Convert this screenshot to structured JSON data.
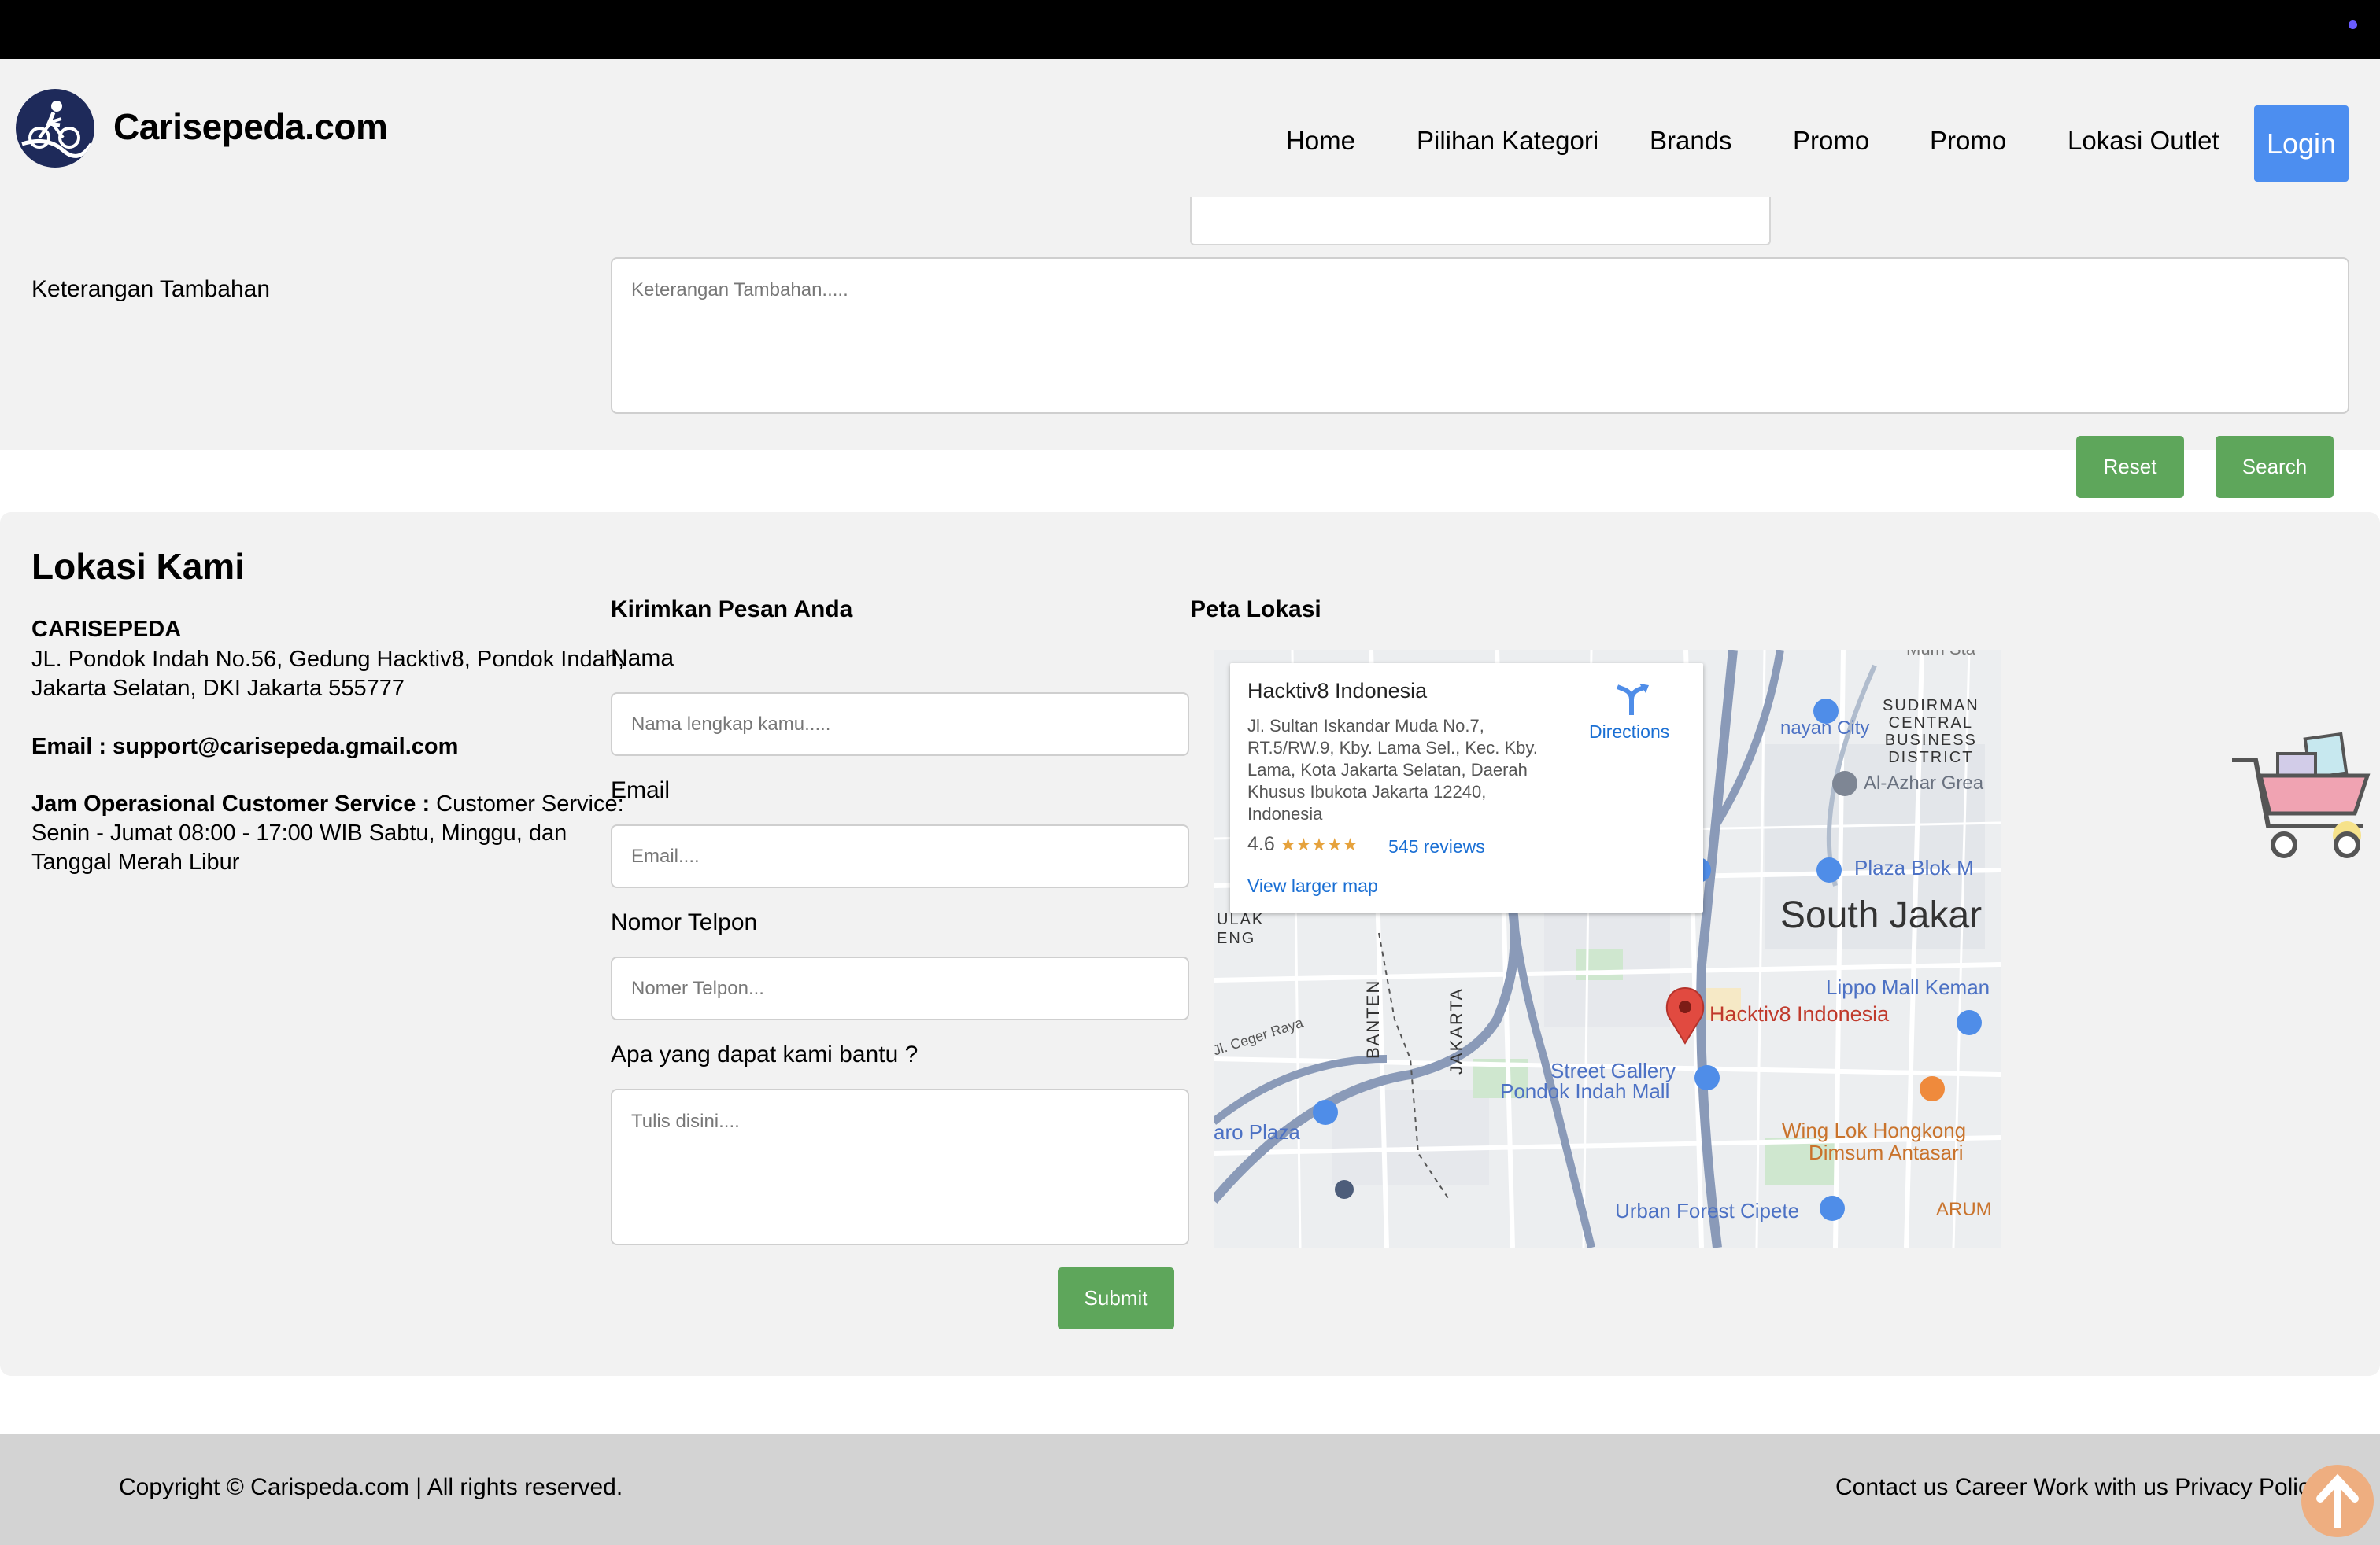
{
  "site": {
    "brand": "Carisepeda.com",
    "accent_color": "#4c8ef0",
    "green_color": "#5ea65b"
  },
  "nav": {
    "items": [
      "Home",
      "Pilihan Kategori",
      "Brands",
      "Promo",
      "Promo",
      "Lokasi Outlet"
    ],
    "login": "Login"
  },
  "search_form": {
    "extra_label": "Keterangan Tambahan",
    "extra_placeholder": "Keterangan Tambahan.....",
    "reset": "Reset",
    "search": "Search"
  },
  "location": {
    "title": "Lokasi Kami",
    "company": "CARISEPEDA",
    "address_line1": "JL. Pondok Indah No.56, Gedung Hacktiv8, Pondok Indah,",
    "address_line2": "Jakarta Selatan, DKI Jakarta 555777",
    "email_label": "Email : support@carisepeda.gmail.com",
    "hours_label": "Jam Operasional Customer Service :",
    "hours_line1_rest": " Customer Service:",
    "hours_line2": "Senin - Jumat 08:00 - 17:00 WIB Sabtu, Minggu, dan",
    "hours_line3": "Tanggal Merah Libur"
  },
  "contact_form": {
    "title": "Kirimkan Pesan Anda",
    "name_label": "Nama",
    "name_placeholder": "Nama lengkap kamu.....",
    "email_label": "Email",
    "email_placeholder": "Email....",
    "phone_label": "Nomor Telpon",
    "phone_placeholder": "Nomer Telpon...",
    "message_label": "Apa yang dapat kami bantu ?",
    "message_placeholder": "Tulis disini....",
    "submit": "Submit"
  },
  "map": {
    "title": "Peta Lokasi",
    "place_name": "Hacktiv8 Indonesia",
    "address_lines": [
      "Jl. Sultan Iskandar Muda No.7,",
      "RT.5/RW.9, Kby. Lama Sel., Kec. Kby.",
      "Lama, Kota Jakarta Selatan, Daerah",
      "Khusus Ibukota Jakarta 12240,",
      "Indonesia"
    ],
    "rating": "4.6",
    "stars": "★★★★★",
    "reviews": "545 reviews",
    "view_larger": "View larger map",
    "directions": "Directions",
    "labels": {
      "city": "South Jakar",
      "marker": "Hacktiv8 Indonesia",
      "sudirman": [
        "SUDIRMAN",
        "CENTRAL",
        "BUSINESS",
        "DISTRICT"
      ],
      "al_azhar": "Al-Azhar Grea",
      "plaza_blok": "Plaza Blok M",
      "lippo": "Lippo Mall Keman",
      "street_gallery": "Street Gallery",
      "pondok_indah": "Pondok Indah Mall",
      "wing_lok": "Wing Lok Hongkong",
      "dimsum": "Dimsum Antasari",
      "urban_forest": "Urban Forest Cipete",
      "aro_plaza": "aro Plaza",
      "ceger_raya": "Jl. Ceger Raya",
      "ulak": "ULAK",
      "eng": "ENG",
      "banten": "BANTEN",
      "jakarta": "JAKARTA",
      "senayan": "nayan City",
      "arum": "ARUM",
      "mu_top": "Mum Sta"
    }
  },
  "footer": {
    "copyright": "Copyright © Carispeda.com | All rights reserved.",
    "links": "Contact us Career Work with us Privacy Policy"
  }
}
